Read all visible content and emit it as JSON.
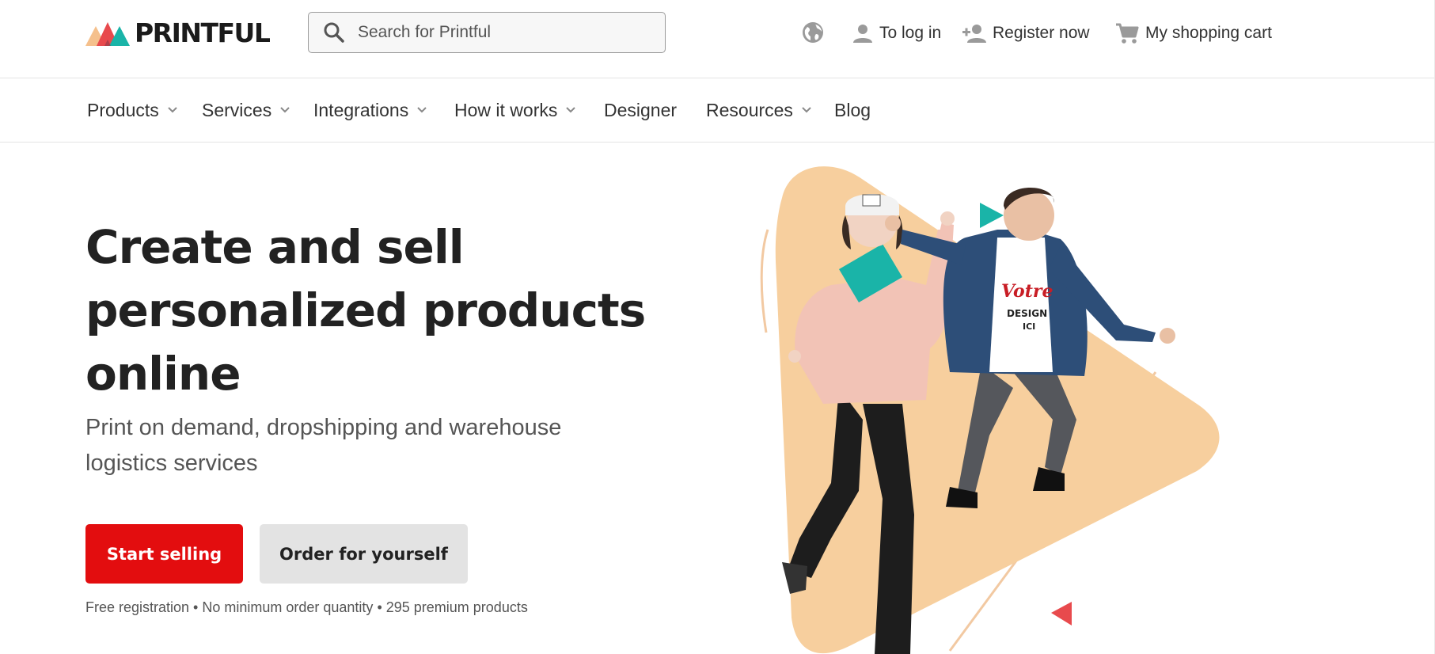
{
  "brand": {
    "name": "PRINTFUL",
    "logo_colors": [
      "#f5c08c",
      "#e84a4d",
      "#1ab4a8"
    ]
  },
  "search": {
    "placeholder": "Search for Printful",
    "icon": "search-icon"
  },
  "header": {
    "language_icon": "globe-icon",
    "login": {
      "label": "To log in",
      "icon": "person-icon"
    },
    "register": {
      "label": "Register now",
      "icon": "person-add-icon"
    },
    "cart": {
      "label": "My shopping cart",
      "icon": "cart-icon"
    }
  },
  "nav": {
    "items": [
      {
        "label": "Products",
        "dropdown": true
      },
      {
        "label": "Services",
        "dropdown": true
      },
      {
        "label": "Integrations",
        "dropdown": true
      },
      {
        "label": "How it works",
        "dropdown": true
      },
      {
        "label": "Designer",
        "dropdown": false
      },
      {
        "label": "Resources",
        "dropdown": true
      },
      {
        "label": "Blog",
        "dropdown": false
      }
    ]
  },
  "hero": {
    "title_lines": [
      "Create and sell",
      "personalized products",
      "online"
    ],
    "subtitle_lines": [
      "Print on demand, dropshipping and warehouse",
      "logistics services"
    ],
    "primary_cta": "Start selling",
    "secondary_cta": "Order for yourself",
    "footnote": "Free registration • No minimum order quantity • 295 premium products",
    "art": {
      "tshirt_text_1": "Votre",
      "tshirt_text_2": "DESIGN",
      "tshirt_text_3": "ICI"
    }
  },
  "colors": {
    "accent_red": "#e30d0f",
    "secondary_gray": "#e3e3e3",
    "peach": "#f7cf9e",
    "teal": "#1ab4a8"
  }
}
